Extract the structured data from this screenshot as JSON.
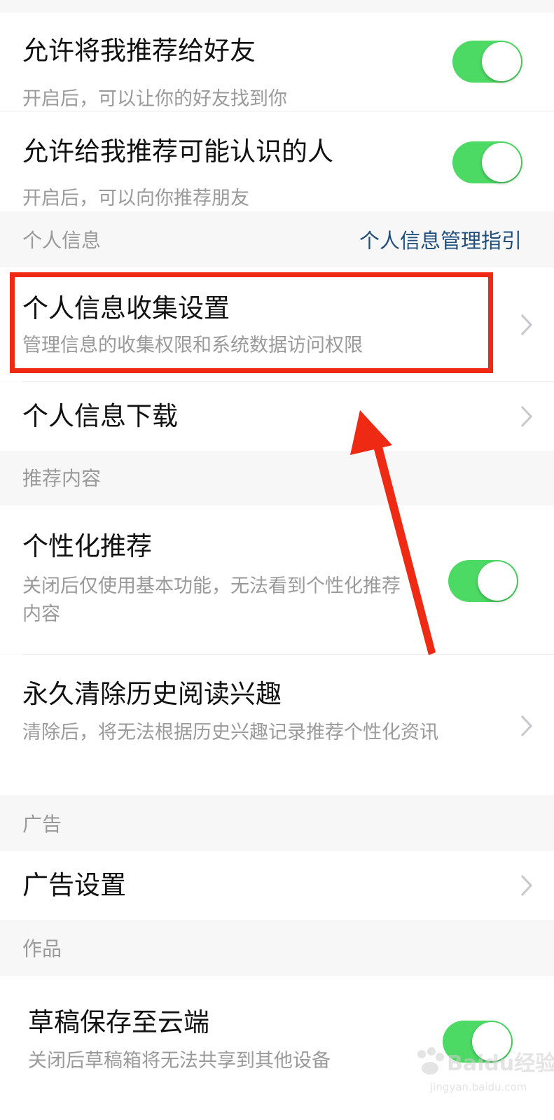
{
  "settings": {
    "recommend_to_friends": {
      "title": "允许将我推荐给好友",
      "subtitle": "开启后，可以让你的好友找到你",
      "enabled": true
    },
    "recommend_people": {
      "title": "允许给我推荐可能认识的人",
      "subtitle": "开启后，可以向你推荐朋友",
      "enabled": true
    }
  },
  "personal_info": {
    "section_label": "个人信息",
    "guide_link": "个人信息管理指引",
    "collection_settings": {
      "title": "个人信息收集设置",
      "subtitle": "管理信息的收集权限和系统数据访问权限"
    },
    "download": {
      "title": "个人信息下载"
    }
  },
  "recommended_content": {
    "section_label": "推荐内容",
    "personalized": {
      "title": "个性化推荐",
      "subtitle": "关闭后仅使用基本功能，无法看到个性化推荐内容",
      "enabled": true
    },
    "clear_history": {
      "title": "永久清除历史阅读兴趣",
      "subtitle": "清除后，将无法根据历史兴趣记录推荐个性化资讯"
    }
  },
  "ads": {
    "section_label": "广告",
    "ad_settings": {
      "title": "广告设置"
    }
  },
  "works": {
    "section_label": "作品",
    "cloud_drafts": {
      "title": "草稿保存至云端",
      "subtitle": "关闭后草稿箱将无法共享到其他设备",
      "enabled": true
    }
  },
  "watermark": {
    "brand": "Baidu经验",
    "site": "jingyan.baidu.com"
  },
  "colors": {
    "toggle_on": "#4cd964",
    "link": "#1f4f7a",
    "annotation_red": "#ee2a14",
    "background": "#f7f7f7"
  },
  "icons": {
    "chevron": "chevron-right-icon",
    "annotation_arrow": "red-arrow",
    "watermark": "baidu-paw-icon"
  }
}
